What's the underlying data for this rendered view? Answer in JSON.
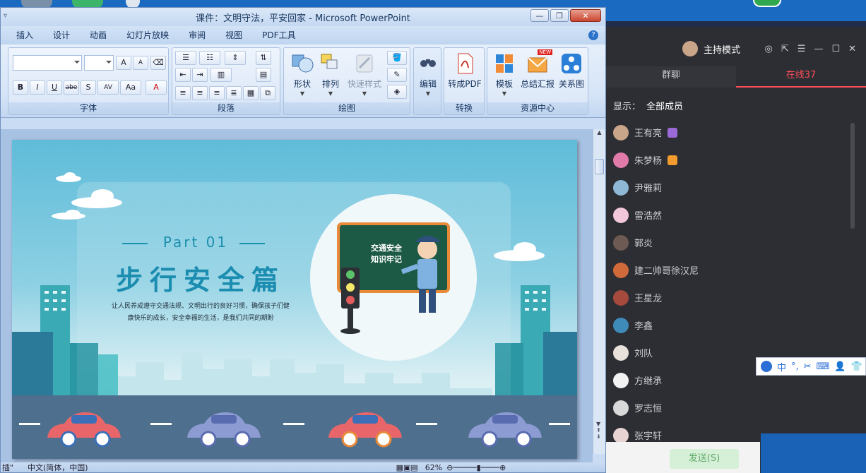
{
  "ppt": {
    "title": "课件：文明守法，平安回家 - Microsoft PowerPoint",
    "window_buttons": [
      "—",
      "❐",
      "✕"
    ],
    "tabs": [
      "插入",
      "设计",
      "动画",
      "幻灯片放映",
      "审阅",
      "视图",
      "PDF工具"
    ],
    "help": "?",
    "groups": {
      "font": "字体",
      "paragraph": "段落",
      "drawing": "绘图",
      "convert": "转换",
      "resources": "资源中心"
    },
    "buttons": {
      "shape": "形状",
      "arrange": "排列",
      "quick_style": "快速样式",
      "edit": "编辑",
      "to_pdf": "转成PDF",
      "template": "模板",
      "summary": "总结汇报",
      "relation": "关系图",
      "new_badge": "NEW"
    },
    "font_buttons": [
      "B",
      "I",
      "U",
      "abe",
      "S",
      "AV",
      "Aa",
      "A"
    ],
    "grow_font": "A",
    "shrink_font": "A",
    "status": {
      "left": "插\"",
      "lang": "中文(简体，中国)",
      "zoom": "62%"
    }
  },
  "slide": {
    "part": "Part 01",
    "title": "步行安全篇",
    "desc_line1": "让人民养成遵守交通法规、文明出行的良好习惯，确保孩子们健",
    "desc_line2": "康快乐的成长，安全幸福的生活，是我们共同的期盼",
    "board_line1": "交通安全",
    "board_line2": "知识牢记"
  },
  "chat": {
    "mode": "主持模式",
    "tabs": {
      "group": "群聊",
      "online": "在线37"
    },
    "filter_label": "显示：",
    "filter_value": "全部成员",
    "members": [
      {
        "name": "王有亮",
        "avatar": "#c9a58a",
        "role": "#9b6ad8"
      },
      {
        "name": "朱梦杨",
        "avatar": "#e07aa8",
        "role": "#f29b2f"
      },
      {
        "name": "尹雅莉",
        "avatar": "#8fb7d6"
      },
      {
        "name": "雷浩然",
        "avatar": "#f2c7d9"
      },
      {
        "name": "郭炎",
        "avatar": "#6d5a52"
      },
      {
        "name": "建二帅哥徐汉尼",
        "avatar": "#d06a3a"
      },
      {
        "name": "王星龙",
        "avatar": "#a64a3e"
      },
      {
        "name": "李鑫",
        "avatar": "#3e8ab8"
      },
      {
        "name": "刘队",
        "avatar": "#e9e1dc"
      },
      {
        "name": "方继承",
        "avatar": "#f2f2f2"
      },
      {
        "name": "罗志恒",
        "avatar": "#d9d9d9"
      },
      {
        "name": "张宇轩",
        "avatar": "#e8d3d3"
      }
    ],
    "send": "发送(S)"
  },
  "ime": {
    "items": [
      "中",
      "°,",
      "✂",
      "⌨",
      "👤",
      "👕"
    ]
  }
}
